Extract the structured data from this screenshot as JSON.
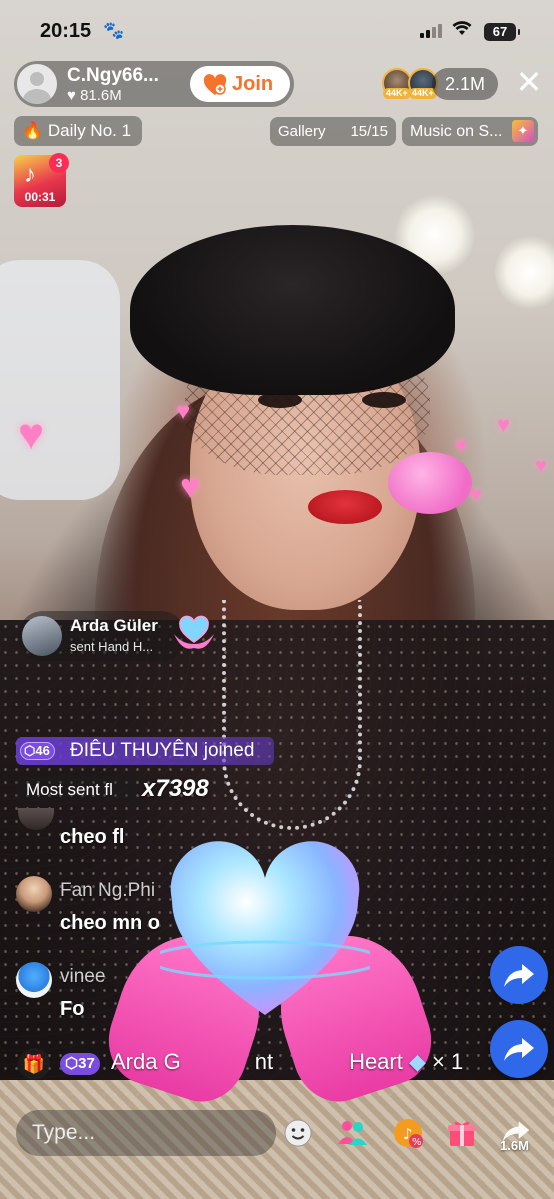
{
  "status_bar": {
    "time": "20:15",
    "battery": "67"
  },
  "host": {
    "name": "C.Ngy66...",
    "likes": "81.6M",
    "join_label": "Join"
  },
  "top_viewers": [
    {
      "badge": "44K+"
    },
    {
      "badge": "44K+"
    }
  ],
  "viewer_count": "2.1M",
  "chips": {
    "daily": "Daily No. 1",
    "gallery_label": "Gallery",
    "gallery_count": "15/15",
    "music": "Music on S..."
  },
  "gift_tile": {
    "badge": "3",
    "timer": "00:31"
  },
  "gift_notification": {
    "user": "Arda Güler",
    "message": "sent Hand H..."
  },
  "join_banner": {
    "level": "46",
    "text": "ĐIÊU THUYÊN joined"
  },
  "most_sent": {
    "label": "Most sent fl",
    "count": "x7398"
  },
  "chat": [
    {
      "name": "",
      "text": "cheo fl"
    },
    {
      "name": "Fan Ng.Phi",
      "text": "cheo mn o"
    },
    {
      "name": "vinee",
      "text": "Fo"
    }
  ],
  "gift_ticker": {
    "level": "37",
    "text_a": "Arda G",
    "text_b": "nt",
    "text_c": "Heart",
    "multiplier": "× 1"
  },
  "comment": {
    "placeholder": "Type..."
  },
  "share": {
    "count": "1.6M"
  },
  "colors": {
    "accent": "#f5732a",
    "join_purple": "#7a4ce0",
    "share_blue": "#2f68e8",
    "badge_red": "#fe2c55"
  }
}
